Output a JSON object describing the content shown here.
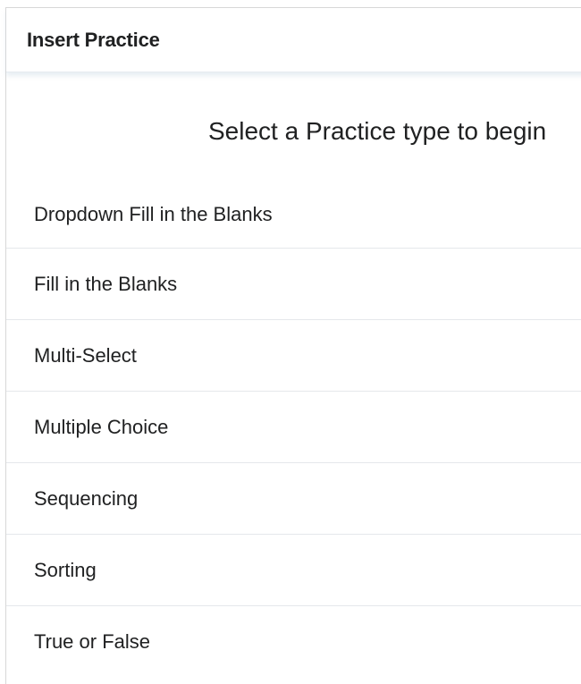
{
  "dialog": {
    "title": "Insert Practice"
  },
  "body": {
    "prompt": "Select a Practice type to begin",
    "practice_types": [
      {
        "label": "Dropdown Fill in the Blanks"
      },
      {
        "label": "Fill in the Blanks"
      },
      {
        "label": "Multi-Select"
      },
      {
        "label": "Multiple Choice"
      },
      {
        "label": "Sequencing"
      },
      {
        "label": "Sorting"
      },
      {
        "label": "True or False"
      }
    ]
  }
}
